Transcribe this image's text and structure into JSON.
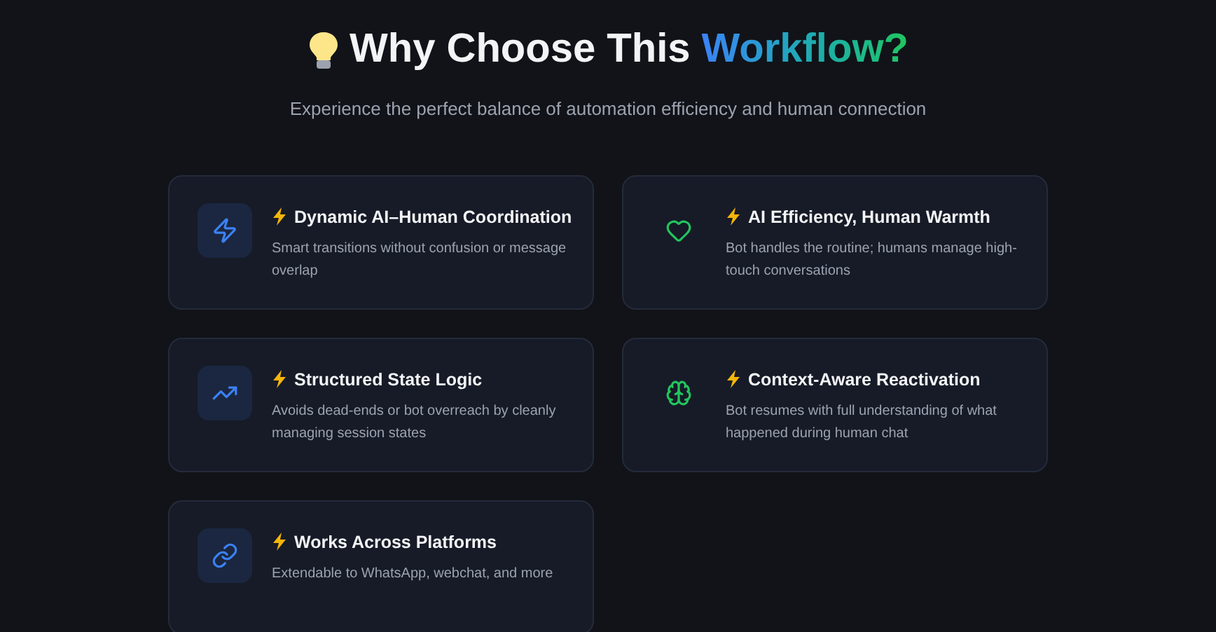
{
  "heading": {
    "lead": "Why Choose This",
    "highlight": "Workflow?"
  },
  "subtitle": "Experience the perfect balance of automation efficiency and human connection",
  "features": [
    {
      "kind": "tile",
      "title": "Dynamic AI–Human Coordination",
      "description": "Smart transitions without confusion or message overlap"
    },
    {
      "kind": "plain",
      "title": "AI Efficiency, Human Warmth",
      "description": "Bot handles the routine; humans manage high-touch conversations"
    },
    {
      "kind": "tile",
      "title": "Structured State Logic",
      "description": "Avoids dead-ends or bot overreach by cleanly managing session states"
    },
    {
      "kind": "plain",
      "title": "Context-Aware Reactivation",
      "description": "Bot resumes with full understanding of what happened during human chat"
    },
    {
      "kind": "tile",
      "title": "Works Across Platforms",
      "description": "Extendable to WhatsApp, webchat, and more"
    }
  ]
}
